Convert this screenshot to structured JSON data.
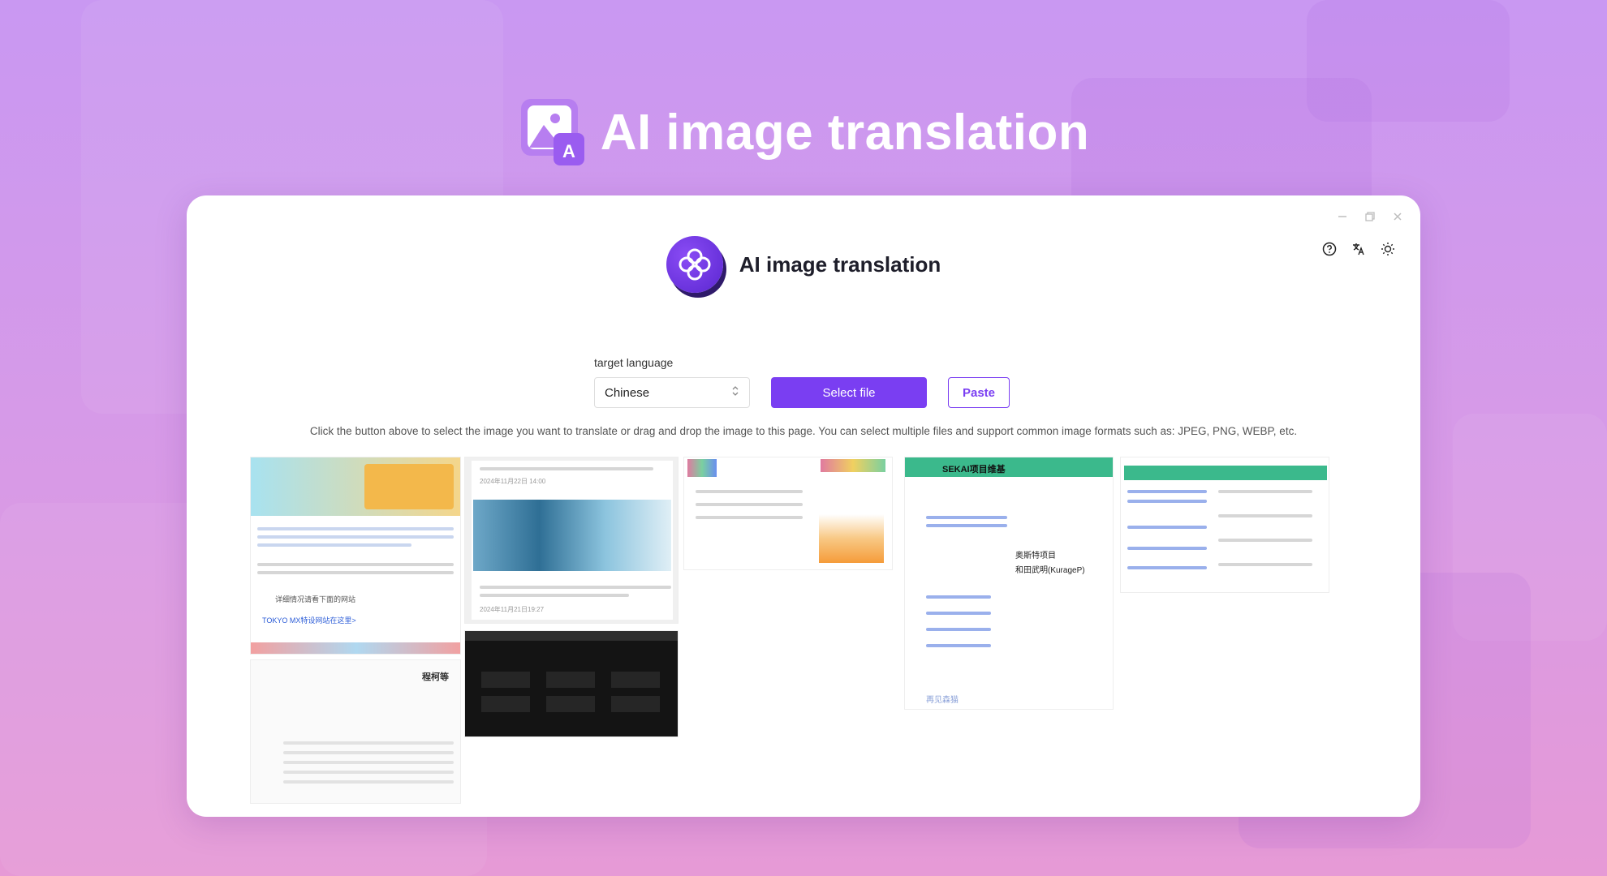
{
  "hero": {
    "title": "AI image translation",
    "icon": "image-translate-icon"
  },
  "window": {
    "controls": [
      "minimize-icon",
      "restore-icon",
      "close-icon"
    ],
    "tools": [
      "help-icon",
      "translate-icon",
      "theme-icon"
    ]
  },
  "app": {
    "title": "AI image translation",
    "logo": "flower-logo-icon"
  },
  "form": {
    "language_label": "target language",
    "language_value": "Chinese",
    "select_file_label": "Select file",
    "paste_label": "Paste"
  },
  "hint": "Click the button above to select the image you want to translate or drag and drop the image to this page. You can select multiple files and support common image formats such as: JPEG, PNG, WEBP, etc.",
  "thumbnails": {
    "t1": {
      "text1": "详细情况请看下面的网站",
      "text2": "TOKYO MX特设网站在这里>",
      "text3": "程柯等"
    },
    "t2": {
      "text1": "2024年11月22日 14:00",
      "text2": "2024年11月21日19:27"
    },
    "t4": {
      "header": "SEKAI项目维基",
      "text1": "奥斯特项目",
      "text2": "和田武明(KurageP)",
      "text3": "再见森猫"
    }
  },
  "colors": {
    "accent": "#7a3ef2",
    "background_top": "#c998f2",
    "background_bottom": "#e69ad6"
  }
}
